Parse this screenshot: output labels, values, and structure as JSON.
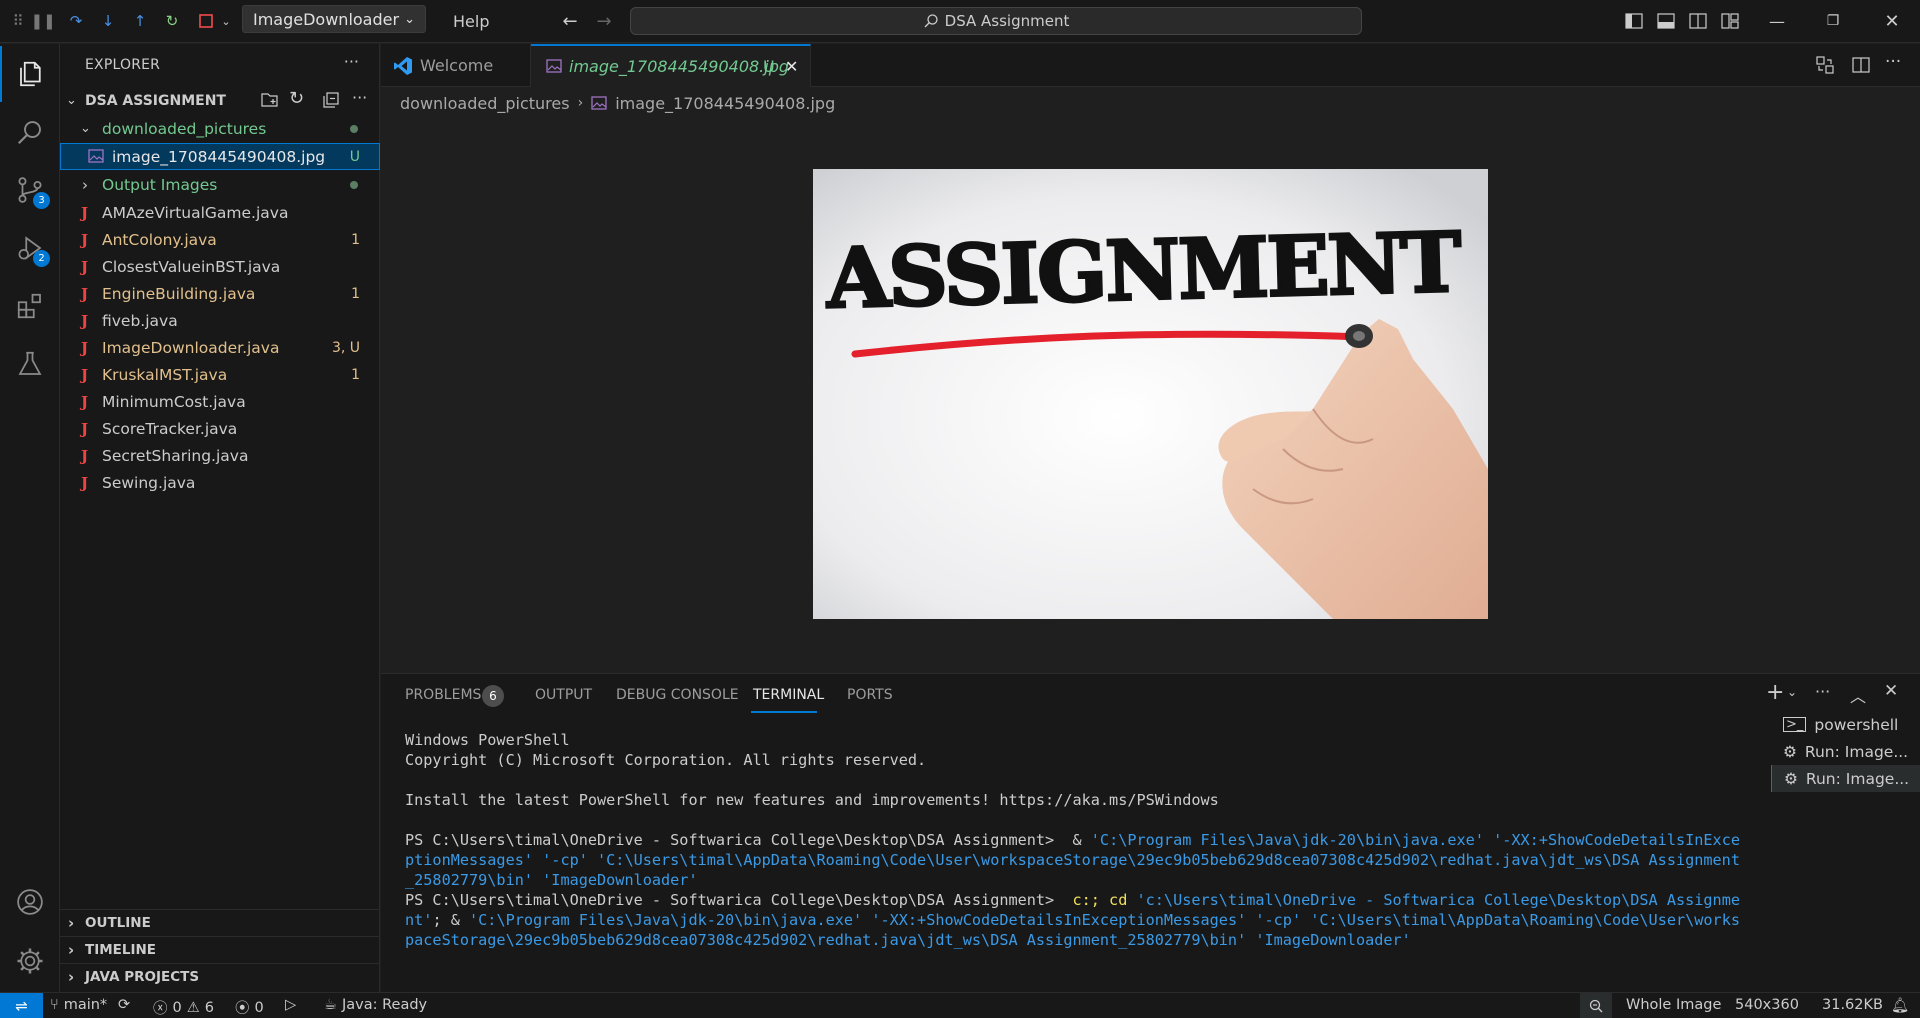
{
  "titlebar": {
    "debug_config": "ImageDownloader",
    "help_menu": "Help",
    "search_text": "DSA Assignment"
  },
  "activity": {
    "scm_badge": "3",
    "debug_badge": "2"
  },
  "sidebar": {
    "title": "EXPLORER",
    "workspace": "DSA ASSIGNMENT",
    "folder_downloaded": "downloaded_pictures",
    "selected_file": "image_1708445490408.jpg",
    "selected_file_status": "U",
    "folder_output": "Output Images",
    "files": [
      {
        "name": "AMAzeVirtualGame.java",
        "deco": ""
      },
      {
        "name": "AntColony.java",
        "deco": "1"
      },
      {
        "name": "ClosestValueinBST.java",
        "deco": ""
      },
      {
        "name": "EngineBuilding.java",
        "deco": "1"
      },
      {
        "name": "fiveb.java",
        "deco": ""
      },
      {
        "name": "ImageDownloader.java",
        "deco": "3, U"
      },
      {
        "name": "KruskalMST.java",
        "deco": "1"
      },
      {
        "name": "MinimumCost.java",
        "deco": ""
      },
      {
        "name": "ScoreTracker.java",
        "deco": ""
      },
      {
        "name": "SecretSharing.java",
        "deco": ""
      },
      {
        "name": "Sewing.java",
        "deco": ""
      }
    ],
    "sections": [
      "OUTLINE",
      "TIMELINE",
      "JAVA PROJECTS"
    ]
  },
  "editor": {
    "tabs": [
      {
        "label": "Welcome"
      },
      {
        "label": "image_1708445490408.jpg",
        "status": "U"
      }
    ],
    "breadcrumb": [
      "downloaded_pictures",
      "image_1708445490408.jpg"
    ],
    "image_text": "ASSIGNMENT"
  },
  "panel": {
    "tabs": [
      "PROBLEMS",
      "OUTPUT",
      "DEBUG CONSOLE",
      "TERMINAL",
      "PORTS"
    ],
    "problems_count": "6",
    "terminal": {
      "line1": "Windows PowerShell",
      "line2": "Copyright (C) Microsoft Corporation. All rights reserved.",
      "line3": "Install the latest PowerShell for new features and improvements! https://aka.ms/PSWindows",
      "prompt": "PS C:\\Users\\timal\\OneDrive - Softwarica College\\Desktop\\DSA Assignment> ",
      "cmd1_amp": " & ",
      "cmd1_args": "'C:\\Program Files\\Java\\jdk-20\\bin\\java.exe' '-XX:+ShowCodeDetailsInExceptionMessages' '-cp' 'C:\\Users\\timal\\AppData\\Roaming\\Code\\User\\workspaceStorage\\29ec9b05beb629d8cea07308c425d902\\redhat.java\\jdt_ws\\DSA Assignment_25802779\\bin' 'ImageDownloader'",
      "cmd2_c": " c:; cd ",
      "cmd2_path": "'c:\\Users\\timal\\OneDrive - Softwarica College\\Desktop\\DSA Assignment'",
      "cmd2_amp": "; & ",
      "cmd2_args": "'C:\\Program Files\\Java\\jdk-20\\bin\\java.exe' '-XX:+ShowCodeDetailsInExceptionMessages' '-cp' 'C:\\Users\\timal\\AppData\\Roaming\\Code\\User\\workspaceStorage\\29ec9b05beb629d8cea07308c425d902\\redhat.java\\jdt_ws\\DSA Assignment_25802779\\bin' 'ImageDownloader'"
    },
    "terminal_list": [
      "powershell",
      "Run: Image...",
      "Run: Image..."
    ]
  },
  "statusbar": {
    "branch": "main*",
    "errors": "0",
    "warnings": "6",
    "ports": "0",
    "java_status": "Java: Ready",
    "zoom_mode": "Whole Image",
    "dimensions": "540x360",
    "file_size": "31.62KB"
  },
  "colors": {
    "accent": "#0078d4",
    "git_untracked": "#73c991",
    "git_modified": "#e2c08d"
  }
}
